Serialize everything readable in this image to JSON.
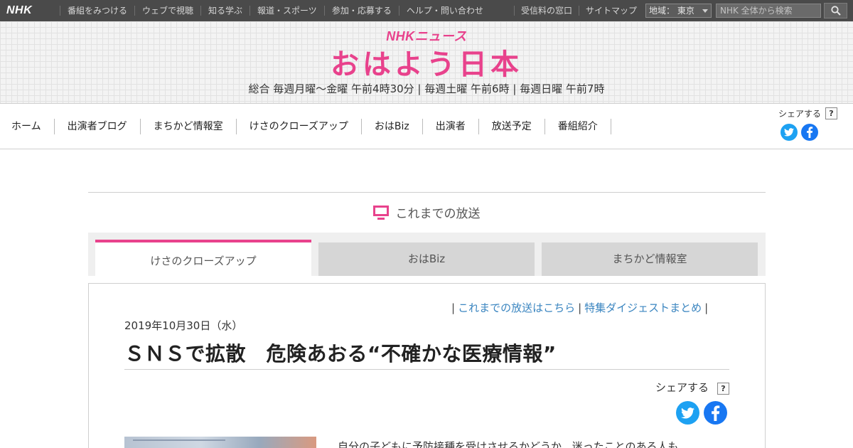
{
  "global_nav": {
    "logo": "NHK",
    "items": [
      "番組をみつける",
      "ウェブで視聴",
      "知る学ぶ",
      "報道・スポーツ",
      "参加・応募する",
      "ヘルプ・問い合わせ"
    ],
    "right_items": [
      "受信料の窓口",
      "サイトマップ"
    ],
    "region_label": "地域： 東京",
    "search_placeholder": "NHK 全体から検索"
  },
  "header": {
    "news_logo": "NHKニュース",
    "title": "おはよう日本",
    "schedule": "総合 毎週月曜～金曜 午前4時30分 | 毎週土曜 午前6時 | 毎週日曜 午前7時"
  },
  "program_nav": {
    "items": [
      "ホーム",
      "出演者ブログ",
      "まちかど情報室",
      "けさのクローズアップ",
      "おはBiz",
      "出演者",
      "放送予定",
      "番組紹介"
    ],
    "share_label": "シェアする",
    "help_label": "?"
  },
  "archive": {
    "heading": "これまでの放送",
    "tabs": [
      "けさのクローズアップ",
      "おはBiz",
      "まちかど情報室"
    ],
    "active_tab": 0
  },
  "article": {
    "link_past": "これまでの放送はこちら",
    "link_digest": "特集ダイジェストまとめ",
    "sep": "|",
    "date": "2019年10月30日（水）",
    "headline": "ＳＮＳで拡散　危険あおる“不確かな医療情報”",
    "share_label": "シェアする",
    "help_label": "?",
    "body_start": "自分の子どもに予防接種を受けさせるかどうか、迷ったことのある人も"
  },
  "colors": {
    "accent": "#e8428c",
    "link": "#3a85c0",
    "topbar": "#4a4a4a",
    "twitter": "#1da1f2",
    "facebook": "#1877f2"
  },
  "icons": [
    "search-icon",
    "tv-icon",
    "twitter-icon",
    "facebook-icon",
    "chevron-down-icon"
  ]
}
